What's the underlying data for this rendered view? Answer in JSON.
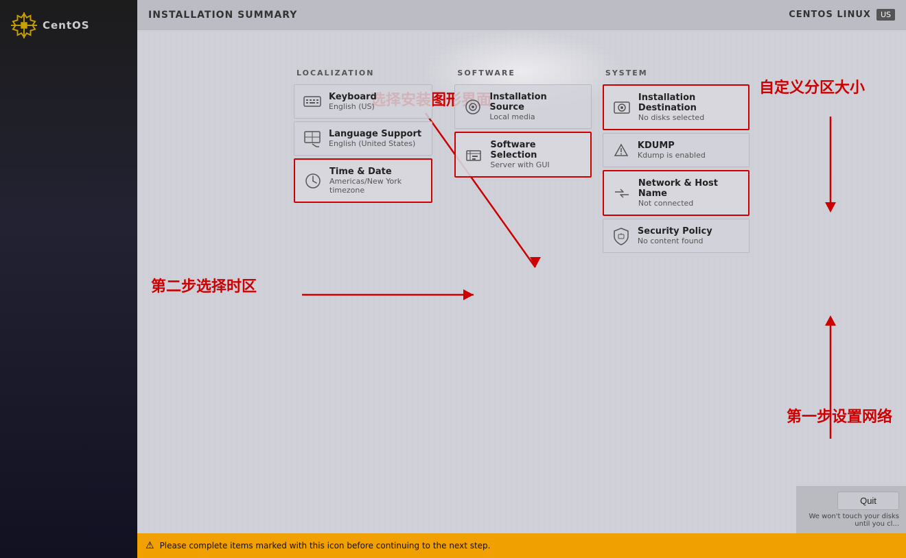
{
  "header": {
    "title": "INSTALLATION SUMMARY",
    "top_right_label": "CENTOS LINUX",
    "lang_badge": "US"
  },
  "logo": {
    "text": "CentOS"
  },
  "annotations": {
    "select_gui": "选择安装图形界面",
    "select_timezone": "第二步选择时区",
    "custom_partition": "自定义分区大小",
    "setup_network": "第一步设置网络"
  },
  "sections": {
    "localization": {
      "header": "LOCALIZATION",
      "items": [
        {
          "id": "keyboard",
          "title": "Keyboard",
          "subtitle": "English (US)",
          "highlighted": false
        },
        {
          "id": "language-support",
          "title": "Language Support",
          "subtitle": "English (United States)",
          "highlighted": false
        },
        {
          "id": "time-date",
          "title": "Time & Date",
          "subtitle": "Americas/New York timezone",
          "highlighted": true
        }
      ]
    },
    "software": {
      "header": "SOFTWARE",
      "items": [
        {
          "id": "installation-source",
          "title": "Installation Source",
          "subtitle": "Local media",
          "highlighted": false
        },
        {
          "id": "software-selection",
          "title": "Software Selection",
          "subtitle": "Server with GUI",
          "highlighted": true
        }
      ]
    },
    "system": {
      "header": "SYSTEM",
      "items": [
        {
          "id": "installation-destination",
          "title": "Installation Destination",
          "subtitle": "No disks selected",
          "highlighted": true
        },
        {
          "id": "kdump",
          "title": "KDUMP",
          "subtitle": "Kdump is enabled",
          "highlighted": false
        },
        {
          "id": "network-host-name",
          "title": "Network & Host Name",
          "subtitle": "Not connected",
          "highlighted": true
        },
        {
          "id": "security-policy",
          "title": "Security Policy",
          "subtitle": "No content found",
          "highlighted": false
        }
      ]
    }
  },
  "bottombar": {
    "text": "Please complete items marked with this icon before continuing to the next step."
  },
  "buttons": {
    "quit": "Quit"
  },
  "quit_note": "We won't touch your disks until you cl..."
}
